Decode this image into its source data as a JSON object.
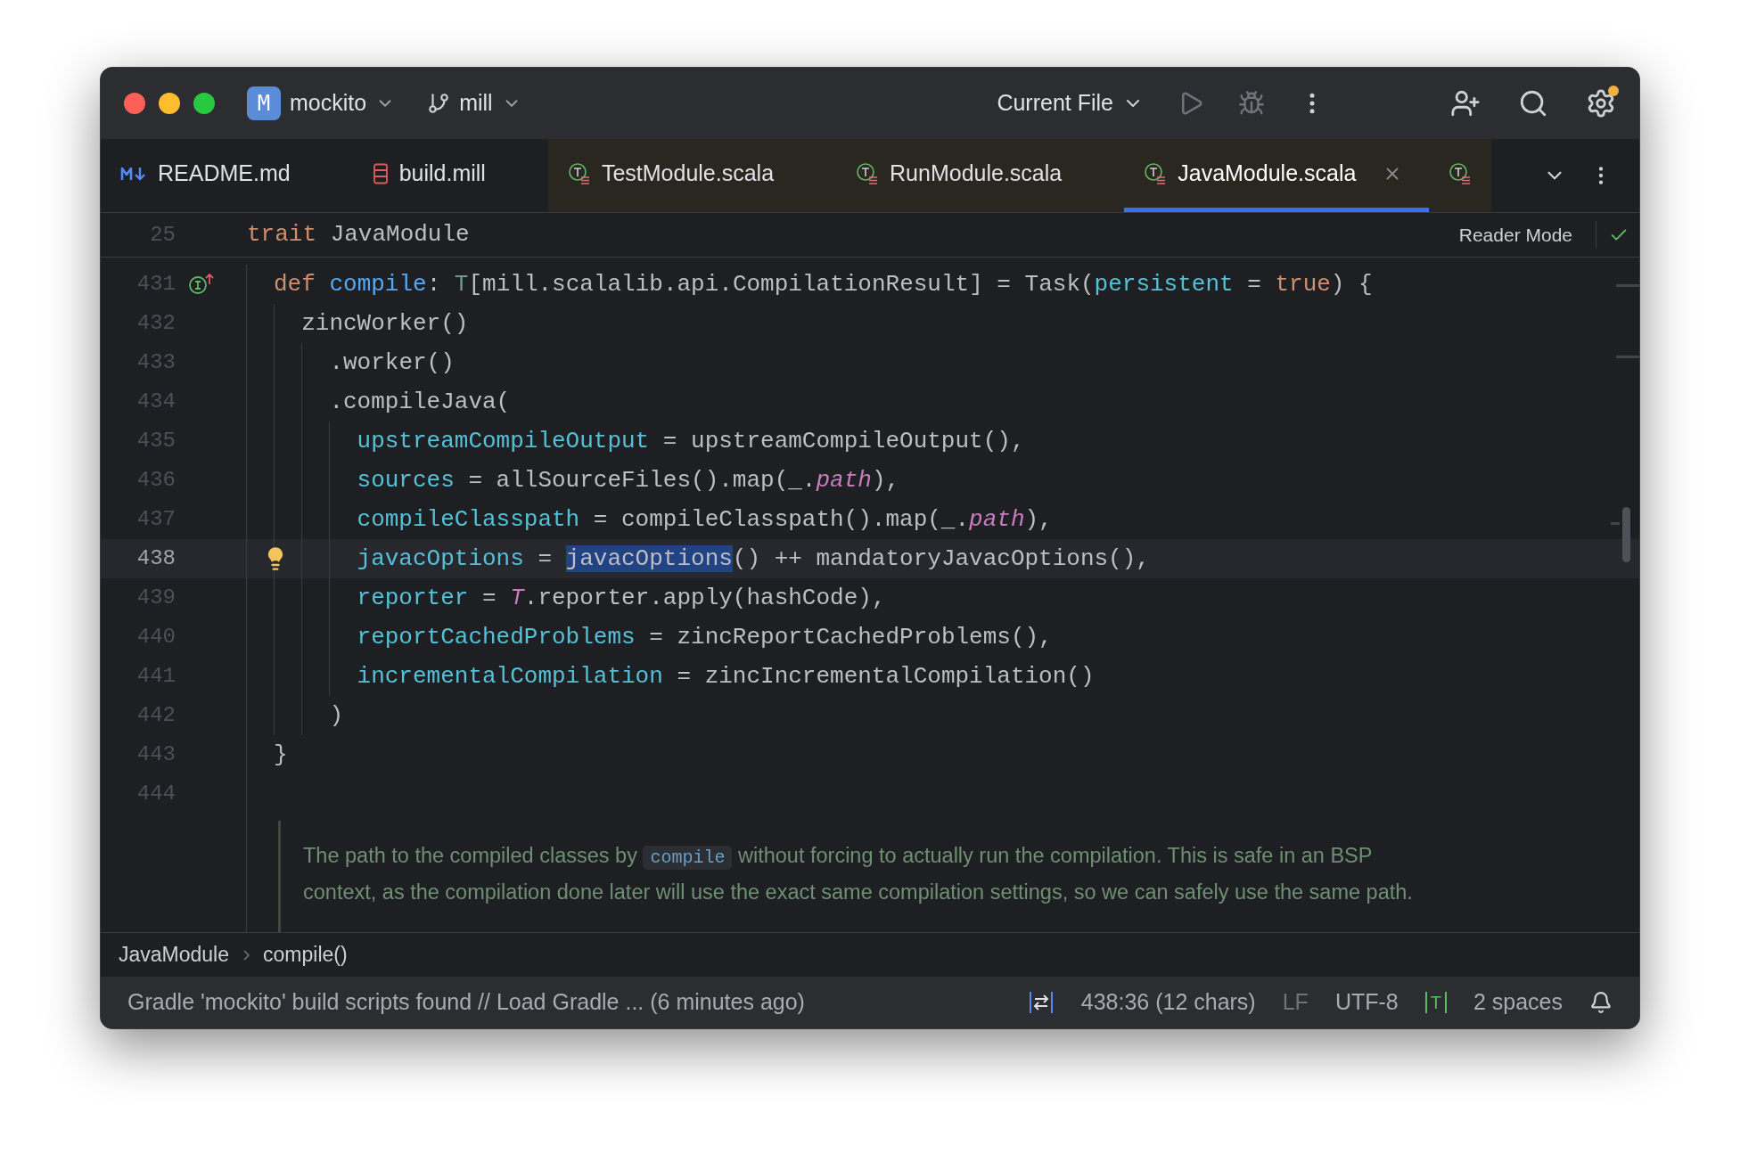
{
  "titlebar": {
    "project_badge": "M",
    "project": "mockito",
    "branch": "mill",
    "run_config": "Current File"
  },
  "tabs": [
    {
      "label": "README.md",
      "kind": "markdown",
      "selected": false,
      "tinted": false,
      "closable": false
    },
    {
      "label": "build.mill",
      "kind": "build",
      "selected": false,
      "tinted": false,
      "closable": false
    },
    {
      "label": "TestModule.scala",
      "kind": "scala",
      "selected": false,
      "tinted": true,
      "closable": false
    },
    {
      "label": "RunModule.scala",
      "kind": "scala",
      "selected": false,
      "tinted": true,
      "closable": false
    },
    {
      "label": "JavaModule.scala",
      "kind": "scala",
      "selected": true,
      "tinted": true,
      "closable": true
    },
    {
      "kind": "scala",
      "selected": false,
      "tinted": true,
      "closable": false
    }
  ],
  "sticky_header": {
    "number": "25",
    "tokens": [
      {
        "text": "trait ",
        "kind": "kw"
      },
      {
        "text": "JavaModule",
        "kind": "plain"
      }
    ],
    "reader_mode": "Reader Mode"
  },
  "lines": [
    {
      "number": "431",
      "implemented": true,
      "current": false,
      "tokens": [
        {
          "text": "def ",
          "kind": "kw"
        },
        {
          "text": "compile",
          "kind": "fn"
        },
        {
          "text": ": ",
          "kind": "plain"
        },
        {
          "text": "T",
          "kind": "type"
        },
        {
          "text": "[mill.scalalib.api.CompilationResult] = Task(",
          "kind": "plain"
        },
        {
          "text": "persistent",
          "kind": "arg"
        },
        {
          "text": " = ",
          "kind": "plain"
        },
        {
          "text": "true",
          "kind": "kw"
        },
        {
          "text": ") {",
          "kind": "plain"
        }
      ],
      "children": [
        {
          "number": "432",
          "current": false,
          "tokens": [
            {
              "text": "zincWorker()",
              "kind": "plain"
            }
          ],
          "children": [
            {
              "number": "433",
              "current": false,
              "tokens": [
                {
                  "text": ".worker()",
                  "kind": "plain"
                }
              ]
            },
            {
              "number": "434",
              "current": false,
              "tokens": [
                {
                  "text": ".compileJava(",
                  "kind": "plain"
                }
              ],
              "children": [
                {
                  "number": "435",
                  "current": false,
                  "tokens": [
                    {
                      "text": "upstreamCompileOutput",
                      "kind": "arg"
                    },
                    {
                      "text": " = upstreamCompileOutput(),",
                      "kind": "plain"
                    }
                  ]
                },
                {
                  "number": "436",
                  "current": false,
                  "tokens": [
                    {
                      "text": "sources",
                      "kind": "arg"
                    },
                    {
                      "text": " = allSourceFiles().map(_.",
                      "kind": "plain"
                    },
                    {
                      "text": "path",
                      "kind": "member"
                    },
                    {
                      "text": "),",
                      "kind": "plain"
                    }
                  ]
                },
                {
                  "number": "437",
                  "current": false,
                  "tokens": [
                    {
                      "text": "compileClasspath",
                      "kind": "arg"
                    },
                    {
                      "text": " = compileClasspath().map(_.",
                      "kind": "plain"
                    },
                    {
                      "text": "path",
                      "kind": "member"
                    },
                    {
                      "text": "),",
                      "kind": "plain"
                    }
                  ]
                },
                {
                  "number": "438",
                  "intention_bulb": true,
                  "current": true,
                  "tokens": [
                    {
                      "text": "javacOptions",
                      "kind": "arg"
                    },
                    {
                      "text": " = ",
                      "kind": "plain"
                    },
                    {
                      "text": "javacOptions",
                      "kind": "plain",
                      "selected": true
                    },
                    {
                      "text": "() ++ mandatoryJavacOptions(),",
                      "kind": "plain"
                    }
                  ]
                },
                {
                  "number": "439",
                  "current": false,
                  "tokens": [
                    {
                      "text": "reporter",
                      "kind": "arg"
                    },
                    {
                      "text": " = ",
                      "kind": "plain"
                    },
                    {
                      "text": "T",
                      "kind": "member"
                    },
                    {
                      "text": ".reporter.apply(hashCode),",
                      "kind": "plain"
                    }
                  ]
                },
                {
                  "number": "440",
                  "current": false,
                  "tokens": [
                    {
                      "text": "reportCachedProblems",
                      "kind": "arg"
                    },
                    {
                      "text": " = zincReportCachedProblems(),",
                      "kind": "plain"
                    }
                  ]
                },
                {
                  "number": "441",
                  "current": false,
                  "tokens": [
                    {
                      "text": "incrementalCompilation",
                      "kind": "arg"
                    },
                    {
                      "text": " = zincIncrementalCompilation()",
                      "kind": "plain"
                    }
                  ]
                }
              ]
            },
            {
              "number": "442",
              "current": false,
              "tokens": [
                {
                  "text": ")",
                  "kind": "plain"
                }
              ]
            }
          ]
        }
      ]
    },
    {
      "number": "443",
      "current": false,
      "tokens": [
        {
          "text": "}",
          "kind": "plain"
        }
      ]
    },
    {
      "number": "444",
      "current": false
    }
  ],
  "doc": {
    "before": "The path to the compiled classes by ",
    "code": "compile",
    "after": " without forcing to actually run the compilation. This is safe in an BSP context, as the compilation done later will use the exact same compilation settings, so we can safely use the same path."
  },
  "breadcrumbs": [
    "JavaModule",
    "compile()"
  ],
  "status_bar": {
    "message": "Gradle 'mockito' build scripts found // Load Gradle ... (6 minutes ago)",
    "position": "438:36 (12 chars)",
    "line_ending": "LF",
    "encoding": "UTF-8",
    "file_type": "T",
    "indent": "2 spaces"
  }
}
